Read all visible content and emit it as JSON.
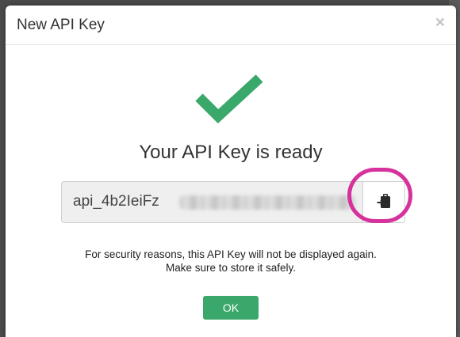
{
  "modal": {
    "title": "New API Key",
    "close_label": "×"
  },
  "content": {
    "heading": "Your API Key is ready",
    "api_key_prefix": "api_4b2IeiFz",
    "copy_icon": "clipboard-paste-icon",
    "notice_line1": "For security reasons, this API Key will not be displayed again.",
    "notice_line2": "Make sure to store it safely."
  },
  "footer": {
    "ok_label": "OK"
  },
  "colors": {
    "success_green": "#3aa86a",
    "highlight_pink": "#d6329c"
  }
}
